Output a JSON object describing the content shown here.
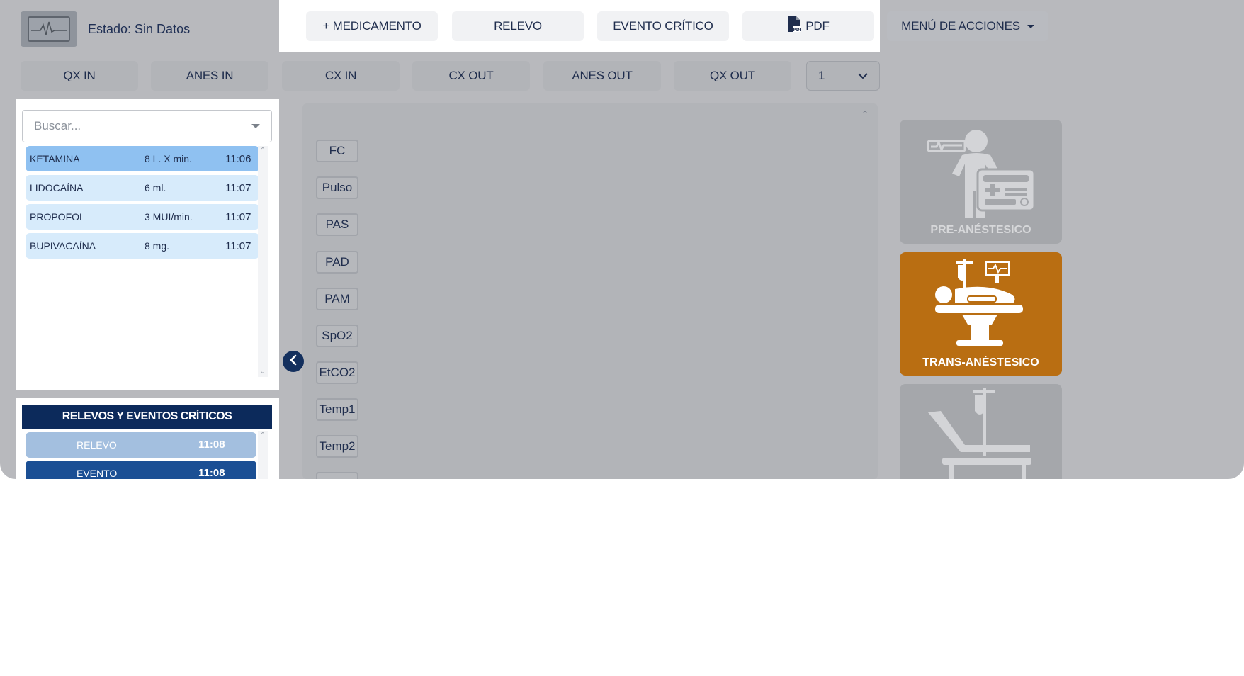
{
  "header": {
    "status_label": "Estado: Sin Datos",
    "logo_icon": "vital-monitor-icon"
  },
  "toolbar": {
    "add_medication": "+ MEDICAMENTO",
    "relief": "RELEVO",
    "critical_event": "EVENTO CRÍTICO",
    "pdf": "PDF",
    "pdf_icon": "pdf-file-icon",
    "actions_menu": "MENÚ DE ACCIONES"
  },
  "time_markers": [
    "QX IN",
    "ANES IN",
    "CX IN",
    "CX OUT",
    "ANES OUT",
    "QX OUT"
  ],
  "page_select": {
    "value": "1"
  },
  "search": {
    "placeholder": "Buscar..."
  },
  "medications": [
    {
      "name": "KETAMINA",
      "dose": "8 L. X min.",
      "time": "11:06",
      "selected": true
    },
    {
      "name": "LIDOCAÍNA",
      "dose": "6 ml.",
      "time": "11:07",
      "selected": false
    },
    {
      "name": "PROPOFOL",
      "dose": "3 MUI/min.",
      "time": "11:07",
      "selected": false
    },
    {
      "name": "BUPIVACAÍNA",
      "dose": "8 mg.",
      "time": "11:07",
      "selected": false
    }
  ],
  "events": {
    "title": "RELEVOS Y EVENTOS CRÍTICOS",
    "items": [
      {
        "label": "RELEVO",
        "time": "11:08"
      },
      {
        "label": "EVENTO",
        "time": "11:08"
      }
    ]
  },
  "parameters": [
    "FC",
    "Pulso",
    "PAS",
    "PAD",
    "PAM",
    "SpO2",
    "EtCO2",
    "Temp1",
    "Temp2"
  ],
  "phases": [
    {
      "label": "PRE-ANÉSTESICO",
      "icon": "patient-monitor-icon",
      "active": false
    },
    {
      "label": "TRANS-ANÉSTESICO",
      "icon": "operating-table-icon",
      "active": true
    },
    {
      "label": "",
      "icon": "recovery-bed-icon",
      "active": false
    }
  ],
  "colors": {
    "primary_dark": "#0c2a5b",
    "active_phase": "#b96e12",
    "selected_row": "#8fc1f1",
    "row": "#d7ebfb",
    "overlay": "#b8b9bd"
  }
}
